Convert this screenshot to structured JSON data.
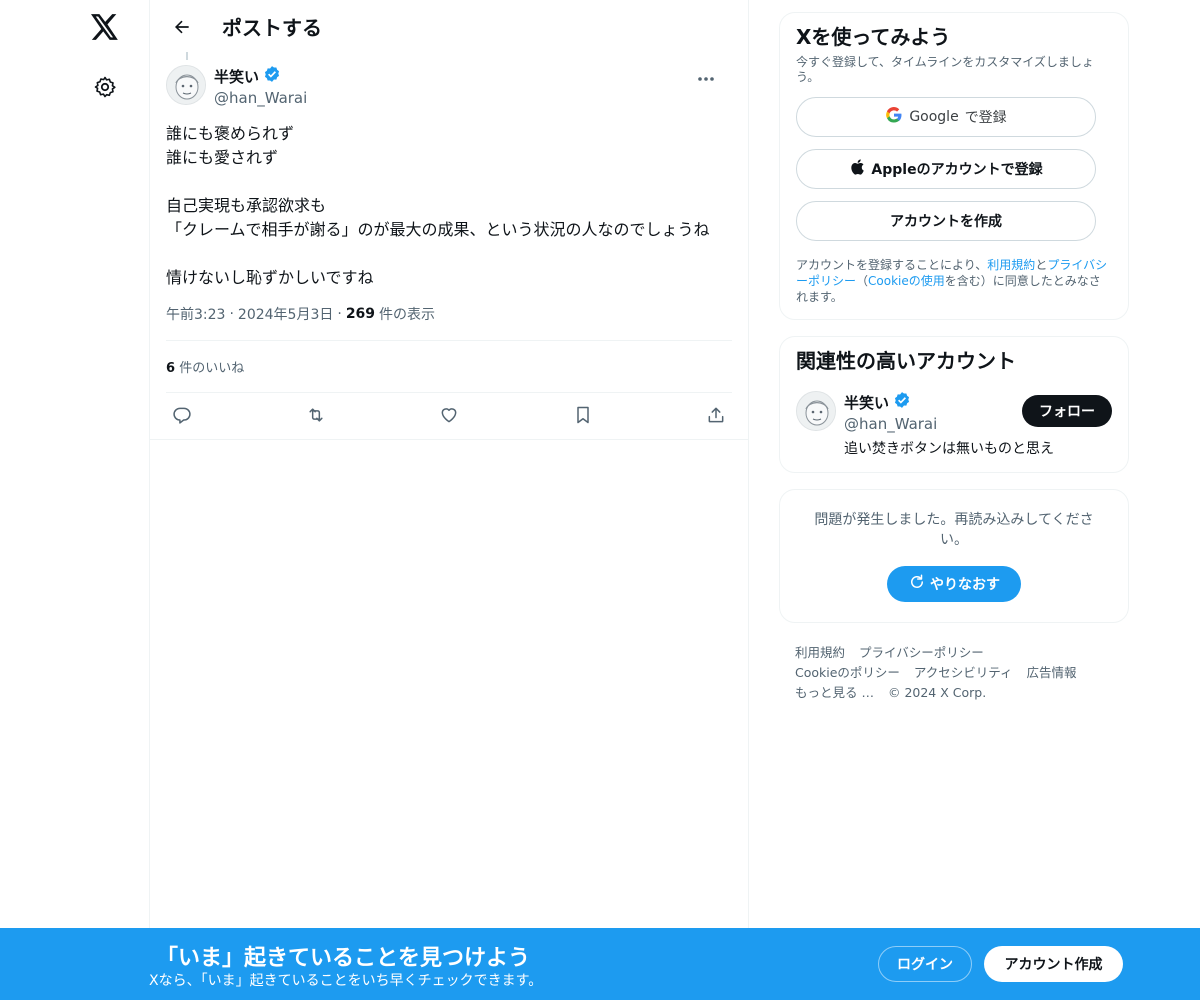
{
  "header": {
    "title": "ポストする"
  },
  "post": {
    "author_name": "半笑い",
    "author_handle": "@han_Warai",
    "body": "誰にも褒められず\n誰にも愛されず\n\n自己実現も承認欲求も\n「クレームで相手が謝る」のが最大の成果、という状況の人なのでしょうね\n\n情けないし恥ずかしいですね",
    "time": "午前3:23",
    "date": "2024年5月3日",
    "views_count": "269",
    "views_label": "件の表示",
    "likes_count": "6",
    "likes_label": "件のいいね"
  },
  "signup_card": {
    "title": "Xを使ってみよう",
    "subtitle": "今すぐ登録して、タイムラインをカスタマイズしましょう。",
    "google_brand": "Google",
    "google_label": "で登録",
    "apple_label": "Appleのアカウントで登録",
    "create_label": "アカウントを作成",
    "legal_1": "アカウントを登録することにより、",
    "legal_terms": "利用規約",
    "legal_2": "と",
    "legal_privacy": "プライバシーポリシー",
    "legal_3": "（",
    "legal_cookie": "Cookieの使用",
    "legal_4": "を含む）に同意したとみなされます。"
  },
  "related": {
    "title": "関連性の高いアカウント",
    "name": "半笑い",
    "handle": "@han_Warai",
    "bio": "追い焚きボタンは無いものと思え",
    "follow_label": "フォロー"
  },
  "error": {
    "text": "問題が発生しました。再読み込みしてください。",
    "retry_label": "やりなおす"
  },
  "footer": {
    "links": [
      "利用規約",
      "プライバシーポリシー",
      "Cookieのポリシー",
      "アクセシビリティ",
      "広告情報",
      "もっと見る …"
    ],
    "copyright": "© 2024 X Corp."
  },
  "banner": {
    "title": "「いま」起きていることを見つけよう",
    "subtitle": "Xなら、「いま」起きていることをいち早くチェックできます。",
    "login_label": "ログイン",
    "signup_label": "アカウント作成"
  },
  "colors": {
    "accent": "#1d9bf0",
    "text": "#0f1419",
    "muted": "#536471",
    "border": "#eff3f4"
  },
  "icons": {
    "logo": "x-logo-icon",
    "settings": "gear-icon",
    "back": "arrow-left-icon",
    "verified": "verified-badge-icon",
    "more": "more-horizontal-icon",
    "reply": "reply-icon",
    "repost": "repost-icon",
    "like": "heart-icon",
    "bookmark": "bookmark-icon",
    "share": "share-icon",
    "apple": "apple-icon",
    "google": "google-g-icon",
    "refresh": "refresh-icon"
  }
}
